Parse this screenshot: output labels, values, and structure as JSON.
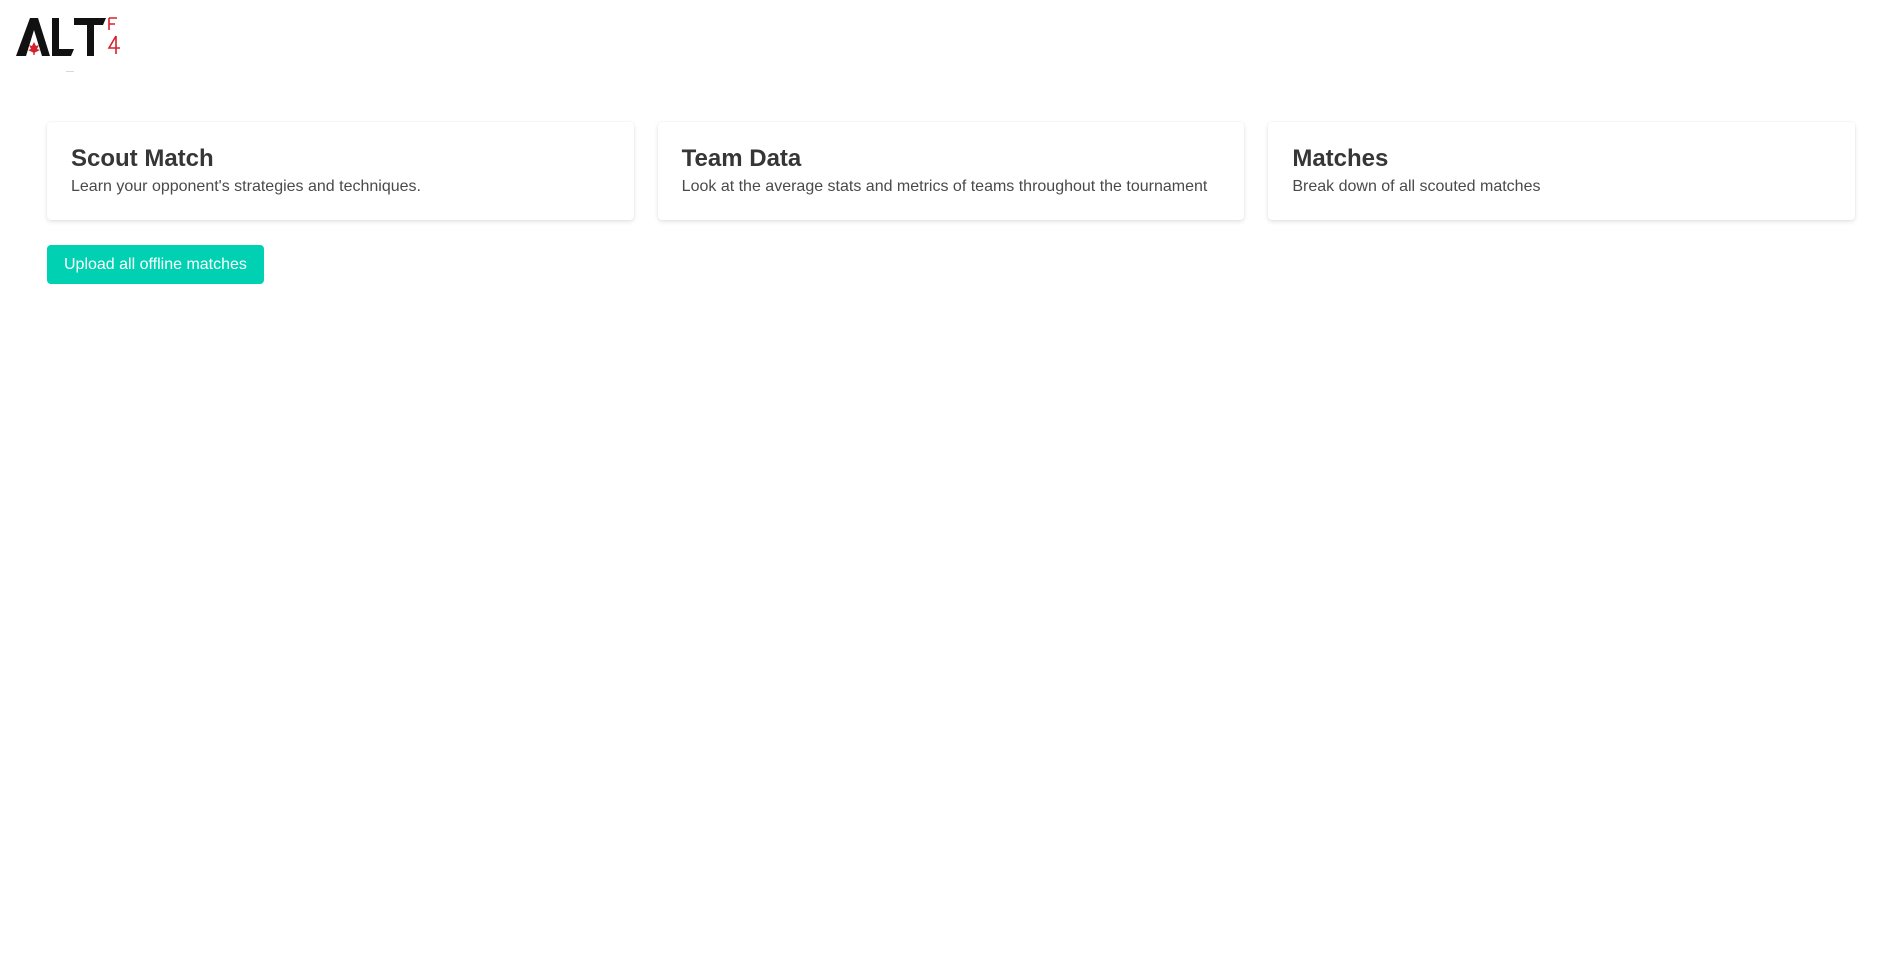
{
  "header": {
    "logo": {
      "text": "ALT",
      "accent_text": "F4",
      "icon": "maple-leaf-icon"
    }
  },
  "cards": [
    {
      "title": "Scout Match",
      "subtitle": "Learn your opponent's strategies and techniques."
    },
    {
      "title": "Team Data",
      "subtitle": "Look at the average stats and metrics of teams throughout the tournament"
    },
    {
      "title": "Matches",
      "subtitle": "Break down of all scouted matches"
    }
  ],
  "actions": {
    "upload_label": "Upload all offline matches"
  },
  "colors": {
    "primary": "#00d1b2",
    "logo_black": "#111111",
    "logo_red": "#d6202c"
  }
}
